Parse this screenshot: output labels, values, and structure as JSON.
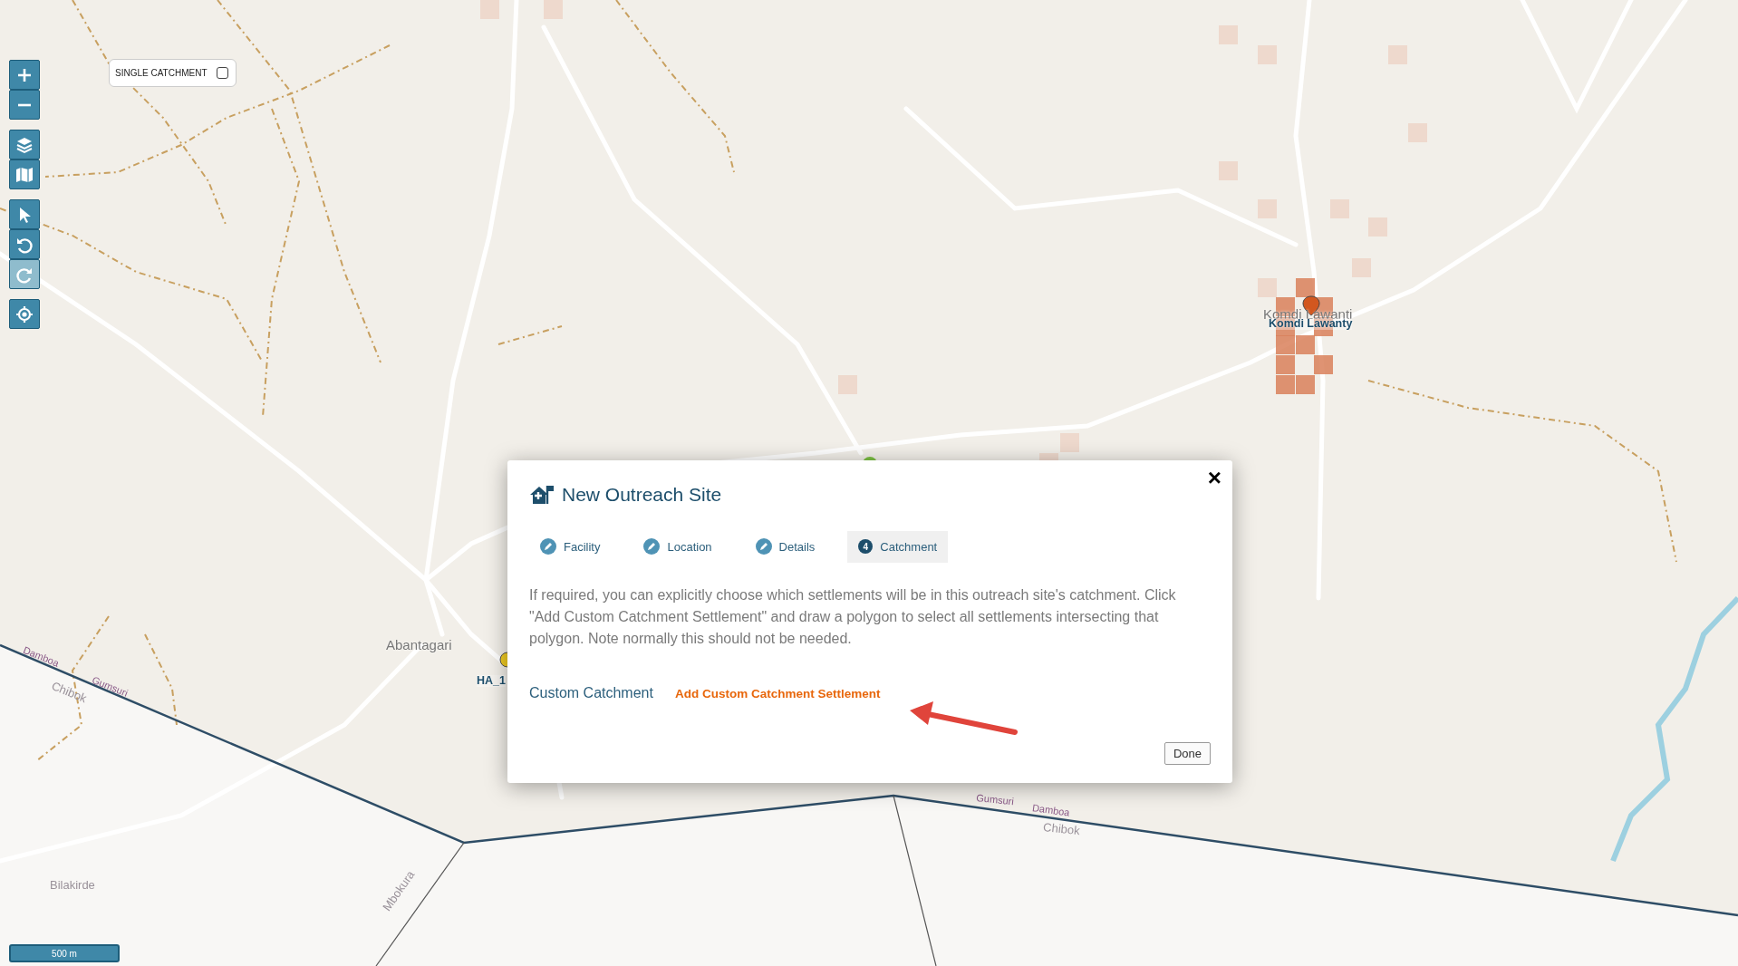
{
  "map": {
    "control_groups": [
      [
        {
          "kind": "zoom-in",
          "disabled": false
        },
        {
          "kind": "zoom-out",
          "disabled": false
        }
      ],
      [
        {
          "kind": "layers",
          "disabled": false
        },
        {
          "kind": "basemap",
          "disabled": false
        }
      ],
      [
        {
          "kind": "select",
          "disabled": false
        },
        {
          "kind": "undo",
          "disabled": false
        },
        {
          "kind": "redo",
          "disabled": true
        }
      ],
      [
        {
          "kind": "locate",
          "disabled": false
        }
      ]
    ],
    "single_catchment": {
      "label": "SINGLE CATCHMENT",
      "checked": false
    },
    "labels": [
      {
        "text": "Komdi Lawanti",
        "kind": "place"
      },
      {
        "text": "Komdi Lawanty",
        "kind": "site"
      },
      {
        "text": "Abantagari",
        "kind": "place"
      },
      {
        "text": "HA_1",
        "kind": "site"
      },
      {
        "text": "Damboa",
        "kind": "boundary"
      },
      {
        "text": "Chibok",
        "kind": "faint"
      },
      {
        "text": "Gumsuri",
        "kind": "boundary"
      },
      {
        "text": "Bilakirde",
        "kind": "faint"
      },
      {
        "text": "Mbokura",
        "kind": "faint"
      },
      {
        "text": "Gumsuri",
        "kind": "boundary"
      },
      {
        "text": "Damboa",
        "kind": "boundary"
      },
      {
        "text": "Chibok",
        "kind": "faint"
      }
    ],
    "scale": "500 m"
  },
  "dialog": {
    "title": "New Outreach Site",
    "close": "×",
    "tabs": [
      {
        "label": "Facility",
        "selected": false
      },
      {
        "label": "Location",
        "selected": false
      },
      {
        "label": "Details",
        "selected": false
      },
      {
        "label": "Catchment",
        "step": "4",
        "selected": true
      }
    ],
    "description": "If required, you can explicitly choose which settlements will be in this outreach site's catchment. Click \"Add Custom Catchment Settlement\" and draw a polygon to select all settlements intersecting that polygon. Note normally this should not be needed.",
    "field_label": "Custom Catchment",
    "action_link": "Add Custom Catchment Settlement",
    "done": "Done"
  }
}
